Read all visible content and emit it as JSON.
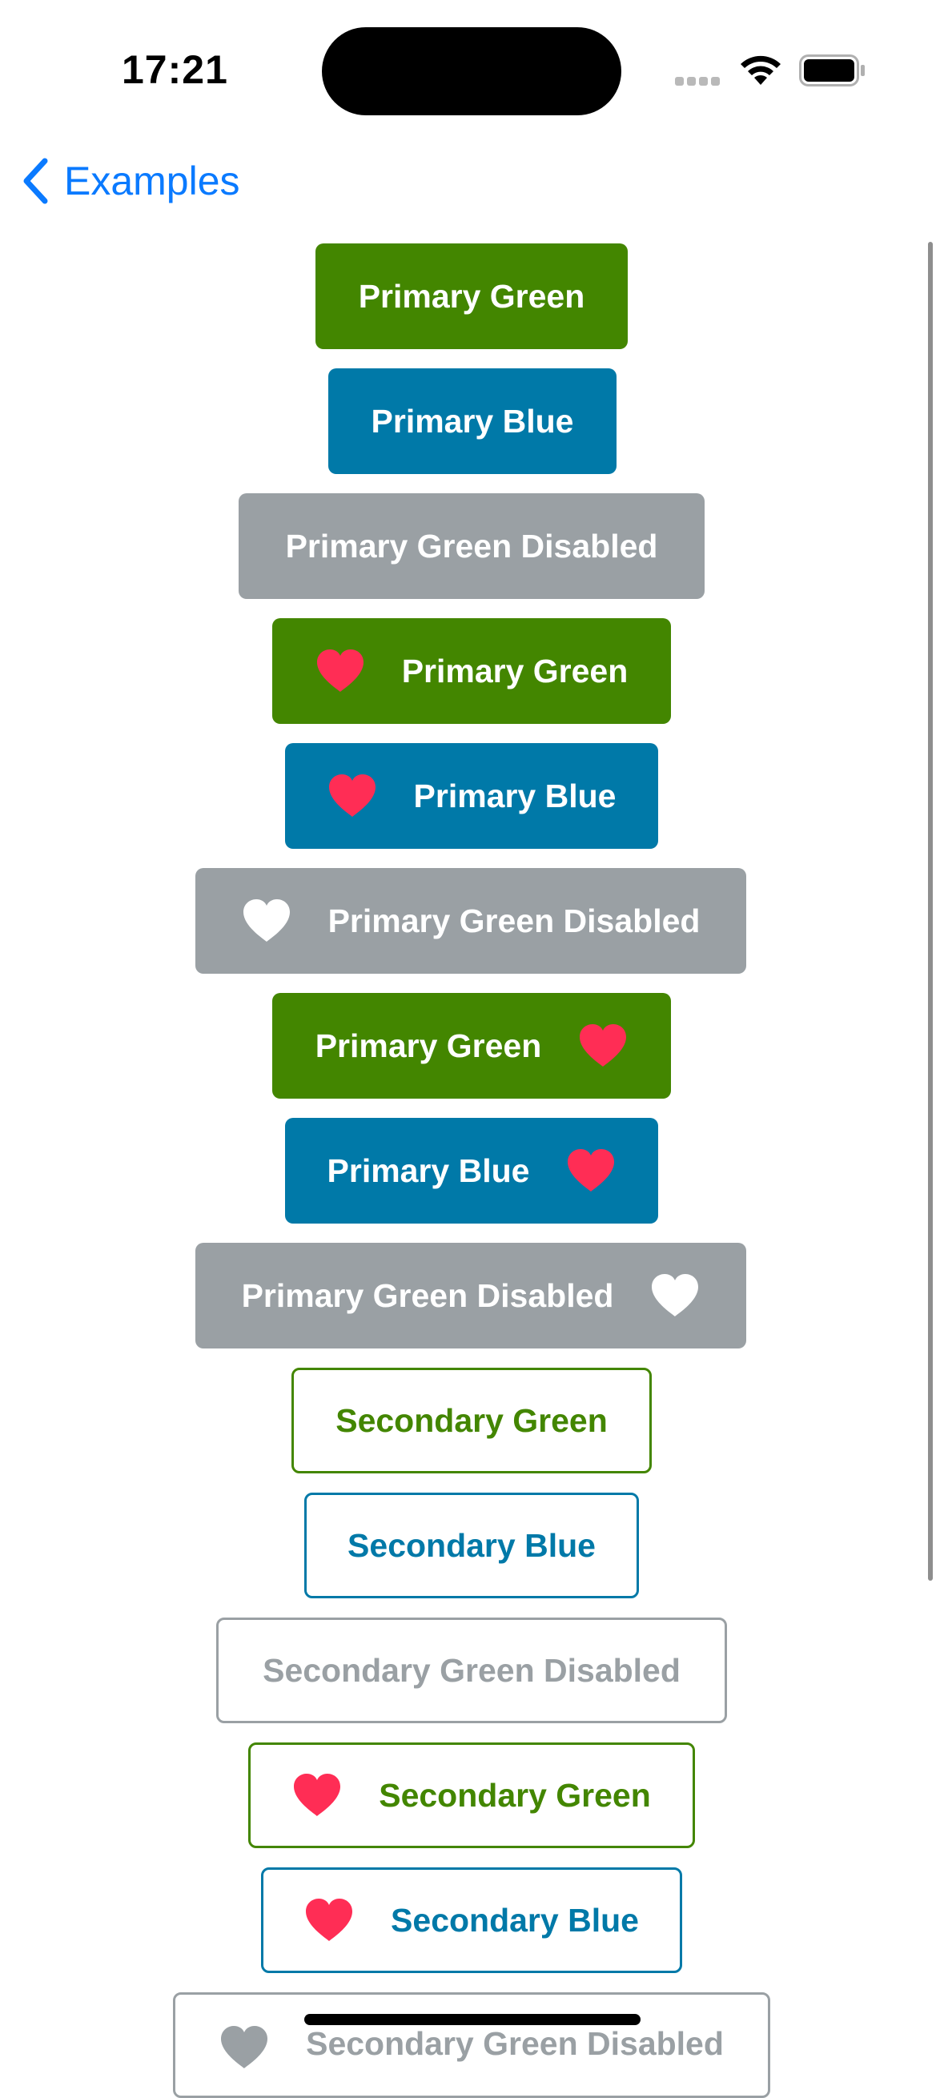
{
  "status_bar": {
    "time": "17:21"
  },
  "nav": {
    "back_label": "Examples"
  },
  "colors": {
    "primary_green": "#438600",
    "primary_blue": "#0079a8",
    "disabled_gray": "#9aa0a4",
    "heart_red": "#ff2d55",
    "link_blue": "#0a7aff"
  },
  "buttons": [
    {
      "label": "Primary Green",
      "style": "primary-green",
      "icon": "none"
    },
    {
      "label": "Primary Blue",
      "style": "primary-blue",
      "icon": "none"
    },
    {
      "label": "Primary Green Disabled",
      "style": "primary-disabled",
      "icon": "none"
    },
    {
      "label": "Primary Green",
      "style": "primary-green",
      "icon": "heart-icon",
      "icon_position": "left"
    },
    {
      "label": "Primary Blue",
      "style": "primary-blue",
      "icon": "heart-icon",
      "icon_position": "left"
    },
    {
      "label": "Primary Green Disabled",
      "style": "primary-disabled",
      "icon": "heart-icon",
      "icon_position": "left"
    },
    {
      "label": "Primary Green",
      "style": "primary-green",
      "icon": "heart-icon",
      "icon_position": "right"
    },
    {
      "label": "Primary Blue",
      "style": "primary-blue",
      "icon": "heart-icon",
      "icon_position": "right"
    },
    {
      "label": "Primary Green Disabled",
      "style": "primary-disabled",
      "icon": "heart-icon",
      "icon_position": "right"
    },
    {
      "label": "Secondary Green",
      "style": "secondary-green",
      "icon": "none"
    },
    {
      "label": "Secondary Blue",
      "style": "secondary-blue",
      "icon": "none"
    },
    {
      "label": "Secondary Green Disabled",
      "style": "secondary-disabled",
      "icon": "none"
    },
    {
      "label": "Secondary Green",
      "style": "secondary-green",
      "icon": "heart-icon",
      "icon_position": "left"
    },
    {
      "label": "Secondary Blue",
      "style": "secondary-blue",
      "icon": "heart-icon",
      "icon_position": "left"
    },
    {
      "label": "Secondary Green Disabled",
      "style": "secondary-disabled",
      "icon": "heart-icon",
      "icon_position": "left"
    }
  ]
}
